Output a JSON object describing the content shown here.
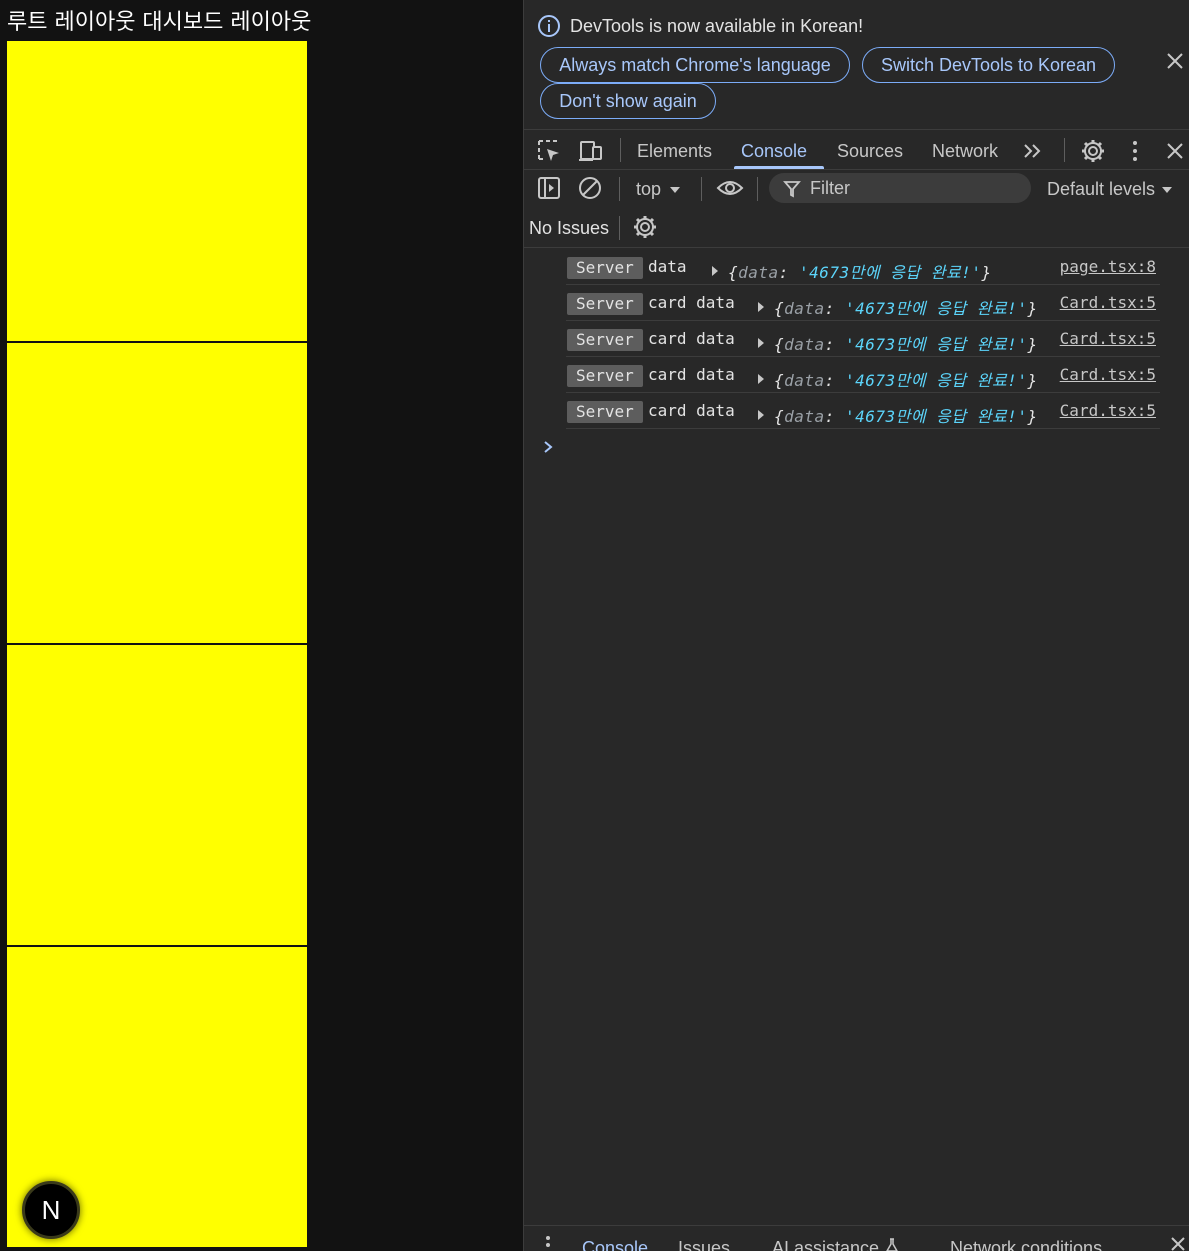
{
  "page": {
    "title": "루트 레이아웃 대시보드 레이아웃",
    "card_color": "#ffff00",
    "badge_letter": "N"
  },
  "devtools": {
    "infobar": {
      "message": "DevTools is now available in Korean!",
      "buttons": {
        "match": "Always match Chrome's language",
        "switch": "Switch DevTools to Korean",
        "dont_show": "Don't show again"
      }
    },
    "tabs": {
      "elements": "Elements",
      "console": "Console",
      "sources": "Sources",
      "network": "Network",
      "active": "Console"
    },
    "toolbar": {
      "context": "top",
      "filter_placeholder": "Filter",
      "levels": "Default levels",
      "issues": "No Issues"
    },
    "console_rows": [
      {
        "badge": "Server",
        "message": "data",
        "object_key": "data",
        "object_value": "'4673만에 응답 완료!'",
        "source": "page.tsx:8"
      },
      {
        "badge": "Server",
        "message": "card data",
        "object_key": "data",
        "object_value": "'4673만에 응답 완료!'",
        "source": "Card.tsx:5"
      },
      {
        "badge": "Server",
        "message": "card data",
        "object_key": "data",
        "object_value": "'4673만에 응답 완료!'",
        "source": "Card.tsx:5"
      },
      {
        "badge": "Server",
        "message": "card data",
        "object_key": "data",
        "object_value": "'4673만에 응답 완료!'",
        "source": "Card.tsx:5"
      },
      {
        "badge": "Server",
        "message": "card data",
        "object_key": "data",
        "object_value": "'4673만에 응답 완료!'",
        "source": "Card.tsx:5"
      }
    ],
    "drawer_tabs": {
      "console": "Console",
      "issues": "Issues",
      "ai": "AI assistance",
      "network_conditions": "Network conditions"
    },
    "colors": {
      "accent": "#a8c7fa",
      "string": "#5cd5fb",
      "panel": "#282828"
    }
  }
}
